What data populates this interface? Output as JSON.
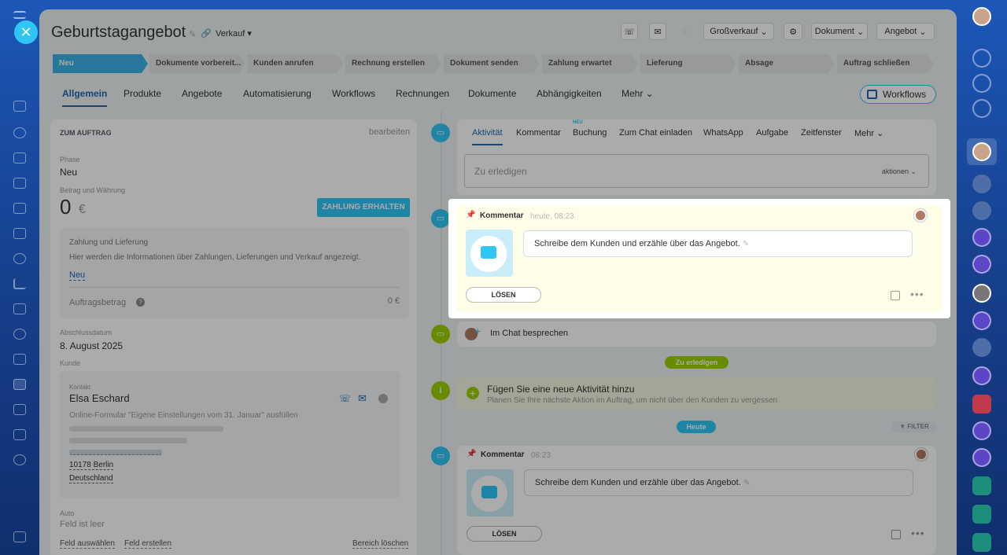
{
  "header": {
    "title": "Geburtstagangebot",
    "pipeline": "Verkauf ▾",
    "buttons": {
      "category": "Großverkauf",
      "document": "Dokument",
      "offer": "Angebot"
    }
  },
  "stages": [
    "Neu",
    "Dokumente vorbereit...",
    "Kunden anrufen",
    "Rechnung erstellen",
    "Dokument senden",
    "Zahlung erwartet",
    "Lieferung",
    "Absage",
    "Auftrag schließen"
  ],
  "tabs": [
    "Allgemein",
    "Produkte",
    "Angebote",
    "Automatisierung",
    "Workflows",
    "Rechnungen",
    "Dokumente",
    "Abhängigkeiten",
    "Mehr"
  ],
  "workflows_button": "Workflows",
  "left": {
    "section_title": "ZUM AUFTRAG",
    "edit": "bearbeiten",
    "phase_label": "Phase",
    "phase_value": "Neu",
    "amount_label": "Betrag und Währung",
    "amount": "0",
    "currency": "€",
    "pay_button": "ZAHLUNG ERHALTEN",
    "payment_title": "Zahlung und Lieferung",
    "payment_desc": "Hier werden die Informationen über Zahlungen, Lieferungen und Verkauf angezeigt.",
    "payment_link": "Neu",
    "order_amount_label": "Auftragsbetrag",
    "order_amount": "0 €",
    "close_date_label": "Abschlussdatum",
    "close_date": "8. August 2025",
    "client_label": "Kunde",
    "contact_label": "Kontakt",
    "contact_name": "Elsa Eschard",
    "contact_source": "Online-Formular \"Eigene Einstellungen vom 31. Januar\" ausfüllen",
    "city": "10178 Berlin",
    "country": "Deutschland",
    "auto_label": "Auto",
    "auto_value": "Feld ist leer",
    "select_field": "Feld auswählen",
    "create_field": "Feld erstellen",
    "delete_section": "Bereich löschen"
  },
  "activity": {
    "tabs": [
      "Aktivität",
      "Kommentar",
      "Buchung",
      "Zum Chat einladen",
      "WhatsApp",
      "Aufgabe",
      "Zeitfenster",
      "Mehr"
    ],
    "new_badge": "NEU",
    "todo_placeholder": "Zu erledigen",
    "actions": "aktionen",
    "comment1": {
      "label": "Kommentar",
      "time": "heute, 08:23",
      "text": "Schreibe dem Kunden und erzähle über das Angebot.",
      "button": "LÖSEN"
    },
    "chat": "Im Chat besprechen",
    "todo_pill": "Zu erledigen",
    "add_title": "Fügen Sie eine neue Aktivität hinzu",
    "add_desc": "Planen Sie Ihre nächste Aktion im Auftrag, um nicht über den Kunden zu vergessen",
    "today_pill": "Heute",
    "filter": "FILTER",
    "comment2": {
      "label": "Kommentar",
      "time": "08:23",
      "text": "Schreibe dem Kunden und erzähle über das Angebot.",
      "button": "LÖSEN"
    }
  }
}
